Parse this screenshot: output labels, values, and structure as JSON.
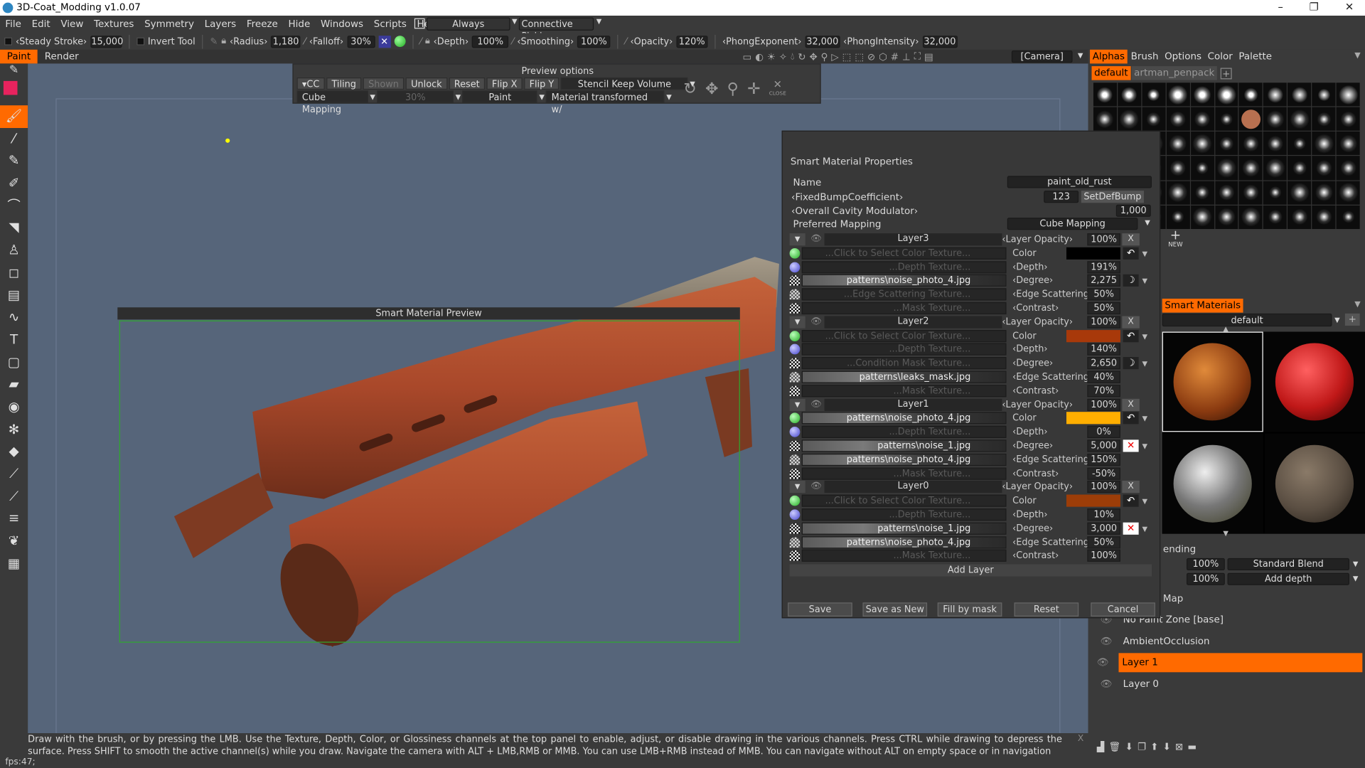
{
  "window": {
    "title": "3D-Coat_Modding v1.0.07",
    "controls": [
      "–",
      "❐",
      "✕"
    ]
  },
  "menubar": {
    "items": [
      "File",
      "Edit",
      "View",
      "Textures",
      "Symmetry",
      "Layers",
      "Freeze",
      "Hide",
      "Windows",
      "Scripts",
      "Help"
    ],
    "always": "Always",
    "picking": "Connective Picki"
  },
  "toolbar": {
    "steady_stroke_label": "‹Steady Stroke›",
    "steady_stroke_value": "15,000",
    "invert_tool_label": "Invert Tool",
    "radius_label": "‹Radius›",
    "radius_value": "1,180",
    "falloff_label": "‹Falloff›",
    "falloff_value": "30%",
    "depth_label": "‹Depth›",
    "depth_value": "100%",
    "smoothing_label": "‹Smoothing›",
    "smoothing_value": "100%",
    "opacity_label": "‹Opacity›",
    "opacity_value": "120%",
    "phong_exp_label": "‹PhongExponent›",
    "phong_exp_value": "32,000",
    "phong_int_label": "‹PhongIntensity›",
    "phong_int_value": "32,000"
  },
  "room_tabs": [
    "Paint",
    "Render"
  ],
  "camera": "[Camera]",
  "preview_options": {
    "title": "Preview options",
    "buttons": [
      "▾CC",
      "Tiling",
      "Shown",
      "Unlock",
      "Reset",
      "Flip X",
      "Flip Y"
    ],
    "stencil": "Stencil Keep Volume",
    "mapping": "Cube Mapping",
    "percent": "30%",
    "paint": "Paint",
    "material": "Material transformed w/",
    "close": "CLOSE"
  },
  "smart_preview": {
    "title": "Smart Material Preview"
  },
  "dialog": {
    "title": "Smart Material Properties",
    "name_label": "Name",
    "name_value": "paint_old_rust",
    "bump_label": "‹FixedBumpCoefficient›",
    "bump_value": "123",
    "bump_button": "SetDefBump",
    "cavity_label": "‹Overall Cavity Modulator›",
    "cavity_value": "1,000",
    "mapping_label": "Preferred Mapping",
    "mapping_value": "Cube Mapping",
    "opacity_label": "‹Layer Opacity›",
    "layers": [
      {
        "name": "Layer3",
        "opacity": "100%",
        "color": "#000000",
        "extra": "moon",
        "rows": [
          [
            "...Click to Select Color Texture...",
            "Color",
            ""
          ],
          [
            "...Depth Texture...",
            "‹Depth›",
            "191%"
          ],
          [
            "patterns\\noise_photo_4.jpg",
            "‹Degree›",
            "2,275"
          ],
          [
            "...Edge Scattering Texture...",
            "‹Edge Scattering›",
            "50%"
          ],
          [
            "...Mask Texture...",
            "‹Contrast›",
            "50%"
          ]
        ]
      },
      {
        "name": "Layer2",
        "opacity": "100%",
        "color": "#a8390a",
        "extra": "moon",
        "rows": [
          [
            "...Click to Select Color Texture...",
            "Color",
            ""
          ],
          [
            "...Depth Texture...",
            "‹Depth›",
            "140%"
          ],
          [
            "...Condition Mask Texture...",
            "‹Degree›",
            "2,650"
          ],
          [
            "patterns\\leaks_mask.jpg",
            "‹Edge Scattering›",
            "40%"
          ],
          [
            "...Mask Texture...",
            "‹Contrast›",
            "70%"
          ]
        ]
      },
      {
        "name": "Layer1",
        "opacity": "100%",
        "color": "#ffae00",
        "extra": "cross",
        "rows": [
          [
            "patterns\\noise_photo_4.jpg",
            "Color",
            ""
          ],
          [
            "...Depth Texture...",
            "‹Depth›",
            "0%"
          ],
          [
            "patterns\\noise_1.jpg",
            "‹Degree›",
            "5,000"
          ],
          [
            "patterns\\noise_photo_4.jpg",
            "‹Edge Scattering›",
            "150%"
          ],
          [
            "...Mask Texture...",
            "‹Contrast›",
            "-50%"
          ]
        ]
      },
      {
        "name": "Layer0",
        "opacity": "100%",
        "color": "#9c3d08",
        "extra": "cross",
        "rows": [
          [
            "...Click to Select Color Texture...",
            "Color",
            ""
          ],
          [
            "...Depth Texture...",
            "‹Depth›",
            "10%"
          ],
          [
            "patterns\\noise_1.jpg",
            "‹Degree›",
            "3,000"
          ],
          [
            "patterns\\noise_photo_4.jpg",
            "‹Edge Scattering›",
            "50%"
          ],
          [
            "...Mask Texture...",
            "‹Contrast›",
            "100%"
          ]
        ]
      }
    ],
    "x_label": "X",
    "add_layer": "Add Layer",
    "buttons": [
      "Save",
      "Save as New",
      "Fill by mask",
      "Reset",
      "Cancel"
    ]
  },
  "right_panel": {
    "tabs": [
      "Alphas",
      "Brush",
      "Options",
      "Color",
      "Palette"
    ],
    "alpha_sets": [
      "default",
      "artman_penpack"
    ],
    "new_label": "NEW",
    "smart_tab": "Smart Materials",
    "smart_folder": "default",
    "blending_label": "ending",
    "blend_rows": [
      {
        "value": "100%",
        "mode": "Standard Blend"
      },
      {
        "value": "100%",
        "mode": "Add depth"
      }
    ],
    "map_label": "Map",
    "layers": [
      {
        "name": "No Paint Zone [base]",
        "selected": false
      },
      {
        "name": "AmbientOcclusion",
        "selected": false
      },
      {
        "name": "Layer 1",
        "selected": true
      },
      {
        "name": "Layer 0",
        "selected": false
      }
    ]
  },
  "status": {
    "hint": "Draw with the brush, or by pressing the LMB. Use the Texture, Depth, Color, or Glossiness channels at the top panel to enable, adjust, or disable drawing in the various channels. Press CTRL while drawing to depress the surface. Press SHIFT to smooth the active channel(s) while you draw. Navigate the camera with ALT + LMB,RMB or MMB. You can use LMB+RMB instead of MMB. You can navigate without ALT on empty space or in navigation",
    "close": "X",
    "fps": "fps:47;"
  },
  "colors": {
    "accent": "#ff6a00",
    "viewport": "#56657a",
    "panel": "#3a3a3a"
  }
}
